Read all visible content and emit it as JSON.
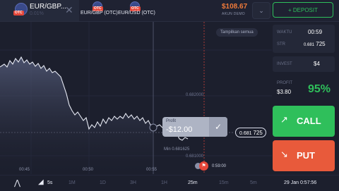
{
  "tabs": [
    {
      "pair": "EUR/GBP...",
      "sub": "0.01%",
      "badge": "OTC"
    },
    {
      "label": "EUR/GBP (OTC)",
      "badge": "OTC"
    },
    {
      "label": "EUR/USD (OTC)",
      "badge": "OTC"
    }
  ],
  "header": {
    "balance": "$108.67",
    "account": "AKUN DEMO",
    "deposit": "+ DEPOSIT"
  },
  "chart": {
    "show_all": "Tampilkan semua",
    "price_labels": [
      "0.682000",
      "0.681000"
    ],
    "current_price_main": "0.681",
    "current_price_pips": "725",
    "tooltip_title": "Profit",
    "tooltip_value": "-$12.00",
    "min_label": "Min 0.681625",
    "expiry_time": "0:59:00",
    "time_labels": [
      "00:45",
      "00:50",
      "00:55"
    ]
  },
  "trade": {
    "time_label": "WAKTU",
    "time_value": "00:59",
    "strike_label": "STR",
    "strike_main": "0.681",
    "strike_pips": "725",
    "invest_label": "INVEST",
    "invest_value": "$4",
    "profit_label": "PROFIT",
    "profit_value": "$3.80",
    "profit_pct": "95%",
    "call": "CALL",
    "put": "PUT"
  },
  "toolbar": {
    "timeframes": [
      "5s",
      "1M",
      "1D",
      "3H",
      "1H",
      "25m",
      "15m",
      "5m"
    ],
    "active": "25m",
    "datetime": "29 Jan 0:57:56"
  },
  "colors": {
    "call": "#2fbf5b",
    "put": "#e85a3b",
    "balance": "#f07a3a",
    "background": "#1c1f2d"
  }
}
